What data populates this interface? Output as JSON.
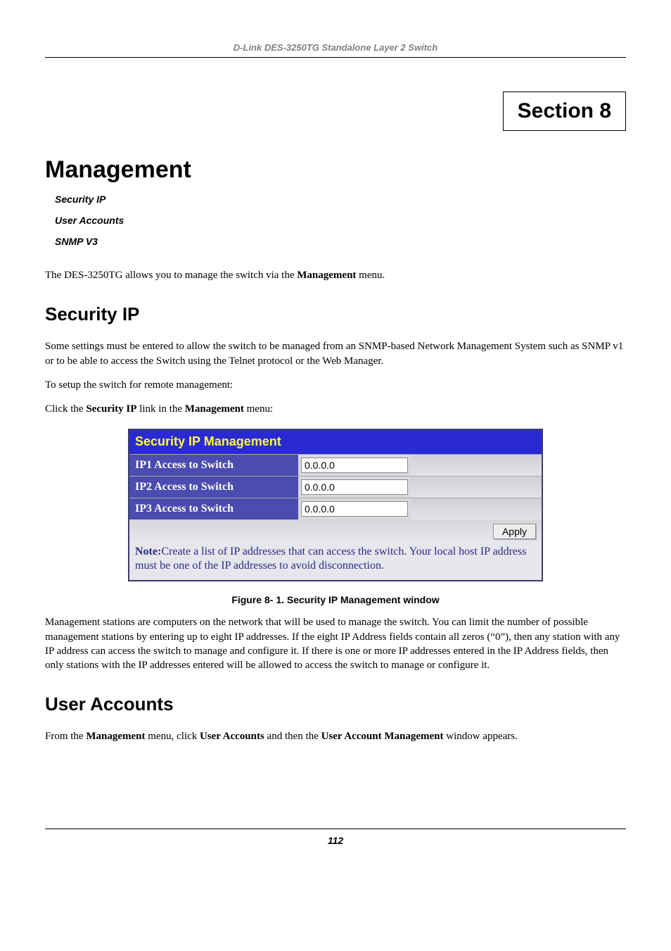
{
  "header": {
    "running_title": "D-Link DES-3250TG Standalone Layer 2 Switch"
  },
  "section_box": "Section 8",
  "title": "Management",
  "sublinks": {
    "a": "Security IP",
    "b": "User Accounts",
    "c": "SNMP V3"
  },
  "intro": {
    "prefix": "The DES-3250TG allows you to manage the switch via the ",
    "bold": "Management",
    "suffix": " menu."
  },
  "security_ip": {
    "heading": "Security IP",
    "p1": "Some settings must be entered to allow the switch to be managed from an SNMP-based Network Management System such as SNMP v1 or to be able to access the Switch using the Telnet protocol or the Web Manager.",
    "p2": "To setup the switch for remote management:",
    "p3_prefix": "Click the ",
    "p3_b1": "Security IP",
    "p3_mid": " link in the ",
    "p3_b2": "Management",
    "p3_suffix": " menu:",
    "panel": {
      "title": "Security IP Management",
      "row1_label": "IP1 Access to Switch",
      "row1_value": "0.0.0.0",
      "row2_label": "IP2 Access to Switch",
      "row2_value": "0.0.0.0",
      "row3_label": "IP3 Access to Switch",
      "row3_value": "0.0.0.0",
      "apply": "Apply",
      "note_bold": "Note:",
      "note_text": "Create a list of IP addresses that can access the switch. Your local host IP address must be one of the IP addresses to avoid disconnection."
    },
    "caption": "Figure 8- 1.  Security IP Management window",
    "p4": "Management stations are computers on the network that will be used to manage the switch. You can limit the number of possible management stations by entering up to eight IP addresses. If the eight IP Address fields contain all zeros (“0”), then any station with any IP address can access the switch to manage and configure it. If there is one or more IP addresses entered in the IP Address fields, then only stations with the IP addresses entered will be allowed to access the switch to manage or configure it."
  },
  "user_accounts": {
    "heading": "User Accounts",
    "p_prefix": "From the ",
    "b1": "Management",
    "p_mid1": " menu, click ",
    "b2": "User Accounts",
    "p_mid2": " and then the ",
    "b3": "User Account Management",
    "p_suffix": " window appears."
  },
  "footer": {
    "page": "112"
  }
}
